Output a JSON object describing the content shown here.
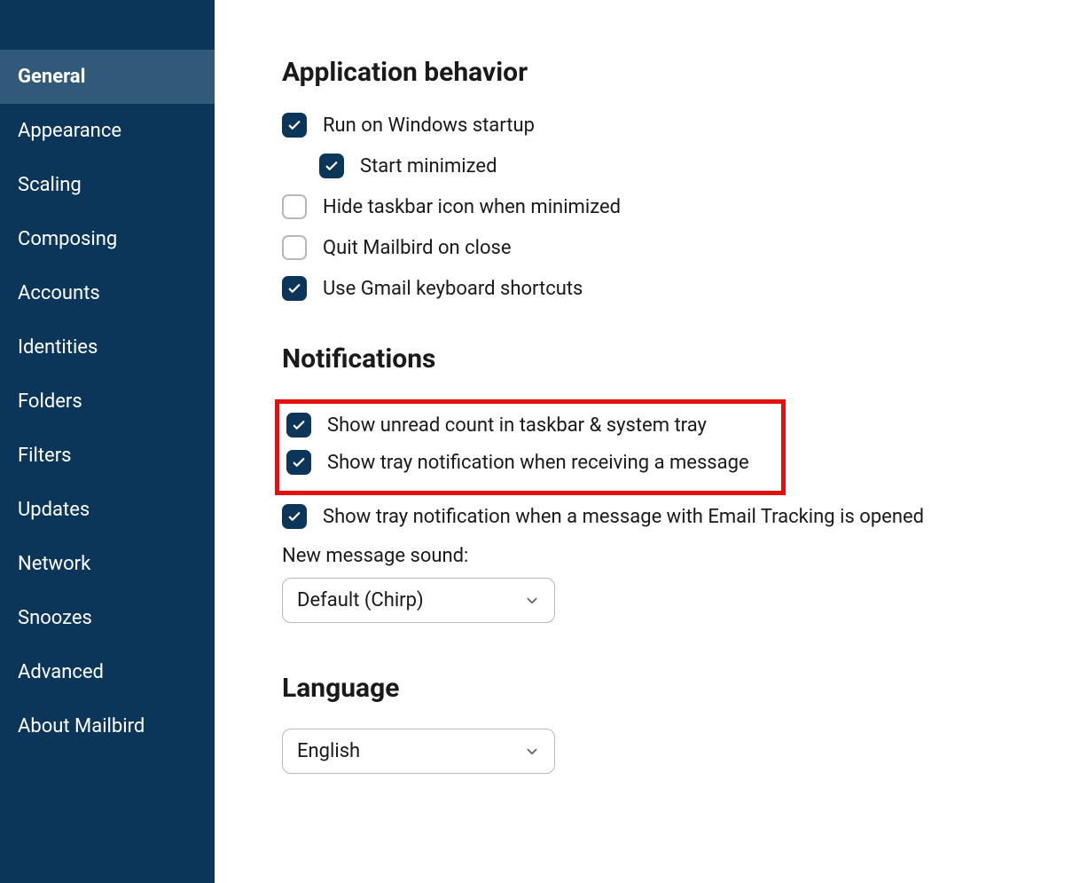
{
  "sidebar": {
    "items": [
      {
        "label": "General",
        "active": true
      },
      {
        "label": "Appearance",
        "active": false
      },
      {
        "label": "Scaling",
        "active": false
      },
      {
        "label": "Composing",
        "active": false
      },
      {
        "label": "Accounts",
        "active": false
      },
      {
        "label": "Identities",
        "active": false
      },
      {
        "label": "Folders",
        "active": false
      },
      {
        "label": "Filters",
        "active": false
      },
      {
        "label": "Updates",
        "active": false
      },
      {
        "label": "Network",
        "active": false
      },
      {
        "label": "Snoozes",
        "active": false
      },
      {
        "label": "Advanced",
        "active": false
      },
      {
        "label": "About Mailbird",
        "active": false
      }
    ]
  },
  "sections": {
    "app_behavior": {
      "heading": "Application behavior",
      "options": {
        "run_on_startup": {
          "label": "Run on Windows startup",
          "checked": true
        },
        "start_minimized": {
          "label": "Start minimized",
          "checked": true
        },
        "hide_taskbar_icon": {
          "label": "Hide taskbar icon when minimized",
          "checked": false
        },
        "quit_on_close": {
          "label": "Quit Mailbird on close",
          "checked": false
        },
        "gmail_shortcuts": {
          "label": "Use Gmail keyboard shortcuts",
          "checked": true
        }
      }
    },
    "notifications": {
      "heading": "Notifications",
      "options": {
        "unread_count": {
          "label": "Show unread count in taskbar & system tray",
          "checked": true
        },
        "tray_notification": {
          "label": "Show tray notification when receiving a message",
          "checked": true
        },
        "email_tracking": {
          "label": "Show tray notification when a message with Email Tracking is opened",
          "checked": true
        }
      },
      "sound_label": "New message sound:",
      "sound_value": "Default (Chirp)"
    },
    "language": {
      "heading": "Language",
      "value": "English"
    }
  }
}
